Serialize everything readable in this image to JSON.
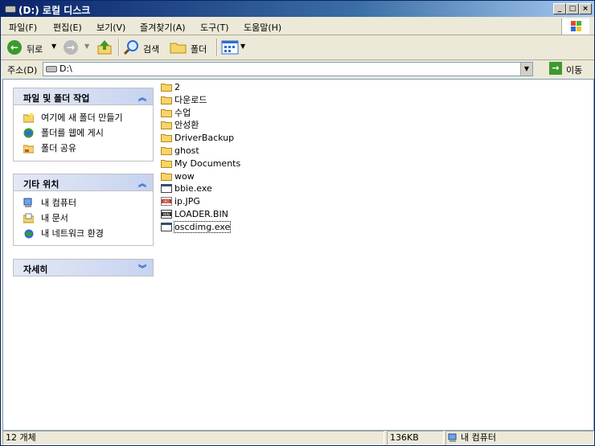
{
  "window": {
    "title": "(D:) 로컬 디스크"
  },
  "menu": [
    "파일(F)",
    "편집(E)",
    "보기(V)",
    "즐겨찾기(A)",
    "도구(T)",
    "도움말(H)"
  ],
  "toolbar": {
    "back": "뒤로",
    "search": "검색",
    "folders": "폴더"
  },
  "address": {
    "label": "주소(D)",
    "value": "D:\\",
    "go": "이동"
  },
  "panels": {
    "tasks": {
      "title": "파일 및 폴더 작업",
      "items": [
        "여기에 새 폴더 만들기",
        "폴더를 웹에 게시",
        "폴더 공유"
      ]
    },
    "places": {
      "title": "기타 위치",
      "items": [
        "내 컴퓨터",
        "내 문서",
        "내 네트워크 환경"
      ]
    },
    "details": {
      "title": "자세히"
    }
  },
  "files": [
    {
      "name": "2",
      "type": "folder"
    },
    {
      "name": "다운로드",
      "type": "folder"
    },
    {
      "name": "수업",
      "type": "folder"
    },
    {
      "name": "안성환",
      "type": "folder"
    },
    {
      "name": "DriverBackup",
      "type": "folder"
    },
    {
      "name": "ghost",
      "type": "folder"
    },
    {
      "name": "My Documents",
      "type": "folder"
    },
    {
      "name": "wow",
      "type": "folder"
    },
    {
      "name": "bbie.exe",
      "type": "exe"
    },
    {
      "name": "ip.JPG",
      "type": "jpg"
    },
    {
      "name": "LOADER.BIN",
      "type": "bin"
    },
    {
      "name": "oscdimg.exe",
      "type": "exe"
    }
  ],
  "status": {
    "count": "12 개체",
    "size": "136KB",
    "location": "내 컴퓨터"
  },
  "colors": {
    "titlebar": "#0a246a",
    "panel_header": "#c6d3f0",
    "folder": "#f5d56b"
  }
}
